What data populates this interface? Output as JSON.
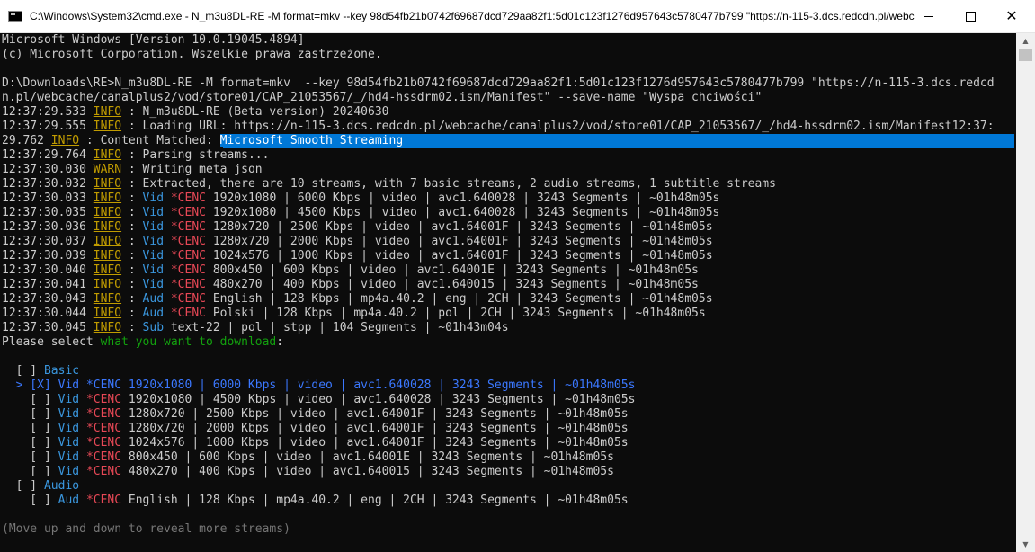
{
  "window": {
    "title": "C:\\Windows\\System32\\cmd.exe - N_m3u8DL-RE  -M format=mkv  --key 98d54fb21b0742f69687dcd729aa82f1:5d01c123f1276d957643c5780477b799 \"https://n-115-3.dcs.redcdn.pl/webc...",
    "minimize_label": "",
    "maximize_label": "",
    "close_label": "✕"
  },
  "console": {
    "header": [
      "Microsoft Windows [Version 10.0.19045.4894]",
      "(c) Microsoft Corporation. Wszelkie prawa zastrzeżone."
    ],
    "command": [
      "D:\\Downloads\\RE>N_m3u8DL-RE -M format=mkv  --key 98d54fb21b0742f69687dcd729aa82f1:5d01c123f1276d957643c5780477b799 \"https://n-115-3.dcs.redcd",
      "n.pl/webcache/canalplus2/vod/store01/CAP_21053567/_/hd4-hssdrm02.ism/Manifest\" --save-name \"Wyspa chciwości\""
    ],
    "log": {
      "level_info": "INFO",
      "level_warn": "WARN",
      "sep": " : ",
      "l1_time": "12:37:29.533 ",
      "l1_msg": "N_m3u8DL-RE (Beta version) 20240630",
      "l2_time": "12:37:29.555 ",
      "l2_msg": "Loading URL: https://n-115-3.dcs.redcdn.pl/webcache/canalplus2/vod/store01/CAP_21053567/_/hd4-hssdrm02.ism/Manifest12:37:",
      "l3_time": "29.762 ",
      "l3_msg": "Content Matched: ",
      "l3_sel": "Microsoft Smooth Streaming",
      "l4_time": "12:37:29.764 ",
      "l4_msg": "Parsing streams...",
      "l5_time": "12:37:30.030 ",
      "l5_msg": "Writing meta json",
      "l6_time": "12:37:30.032 ",
      "l6_msg": "Extracted, there are 10 streams, with 7 basic streams, 2 audio streams, 1 subtitle streams",
      "s1_time": "12:37:30.033 ",
      "s1_rest": " 1920x1080 | 6000 Kbps | video | avc1.640028 | 3243 Segments | ~01h48m05s",
      "s2_time": "12:37:30.035 ",
      "s2_rest": " 1920x1080 | 4500 Kbps | video | avc1.640028 | 3243 Segments | ~01h48m05s",
      "s3_time": "12:37:30.036 ",
      "s3_rest": " 1280x720 | 2500 Kbps | video | avc1.64001F | 3243 Segments | ~01h48m05s",
      "s4_time": "12:37:30.037 ",
      "s4_rest": " 1280x720 | 2000 Kbps | video | avc1.64001F | 3243 Segments | ~01h48m05s",
      "s5_time": "12:37:30.039 ",
      "s5_rest": " 1024x576 | 1000 Kbps | video | avc1.64001F | 3243 Segments | ~01h48m05s",
      "s6_time": "12:37:30.040 ",
      "s6_rest": " 800x450 | 600 Kbps | video | avc1.64001E | 3243 Segments | ~01h48m05s",
      "s7_time": "12:37:30.041 ",
      "s7_rest": " 480x270 | 400 Kbps | video | avc1.640015 | 3243 Segments | ~01h48m05s",
      "a1_time": "12:37:30.043 ",
      "a1_rest": " English | 128 Kbps | mp4a.40.2 | eng | 2CH | 3243 Segments | ~01h48m05s",
      "a2_time": "12:37:30.044 ",
      "a2_rest": " Polski | 128 Kbps | mp4a.40.2 | pol | 2CH | 3243 Segments | ~01h48m05s",
      "t1_time": "12:37:30.045 ",
      "t1_rest": " text-22 | pol | stpp | 104 Segments | ~01h43m04s",
      "vid": "Vid",
      "aud": "Aud",
      "sub": "Sub",
      "cenc": "*CENC"
    },
    "prompt": {
      "prefix": "Please select ",
      "highlight": "what you want to download",
      "suffix": ":"
    },
    "selector": {
      "group_basic_box": "  [ ] ",
      "group_basic": "Basic",
      "row1": "  > [X] Vid *CENC 1920x1080 | 6000 Kbps | video | avc1.640028 | 3243 Segments | ~01h48m05s",
      "row_prefix": "    [ ] ",
      "r2_rest": " 1920x1080 | 4500 Kbps | video | avc1.640028 | 3243 Segments | ~01h48m05s",
      "r3_rest": " 1280x720 | 2500 Kbps | video | avc1.64001F | 3243 Segments | ~01h48m05s",
      "r4_rest": " 1280x720 | 2000 Kbps | video | avc1.64001F | 3243 Segments | ~01h48m05s",
      "r5_rest": " 1024x576 | 1000 Kbps | video | avc1.64001F | 3243 Segments | ~01h48m05s",
      "r6_rest": " 800x450 | 600 Kbps | video | avc1.64001E | 3243 Segments | ~01h48m05s",
      "r7_rest": " 480x270 | 400 Kbps | video | avc1.640015 | 3243 Segments | ~01h48m05s",
      "group_audio_box": "  [ ] ",
      "group_audio": "Audio",
      "ra1_rest": " English | 128 Kbps | mp4a.40.2 | eng | 2CH | 3243 Segments | ~01h48m05s",
      "hint": "(Move up and down to reveal more streams)"
    }
  }
}
